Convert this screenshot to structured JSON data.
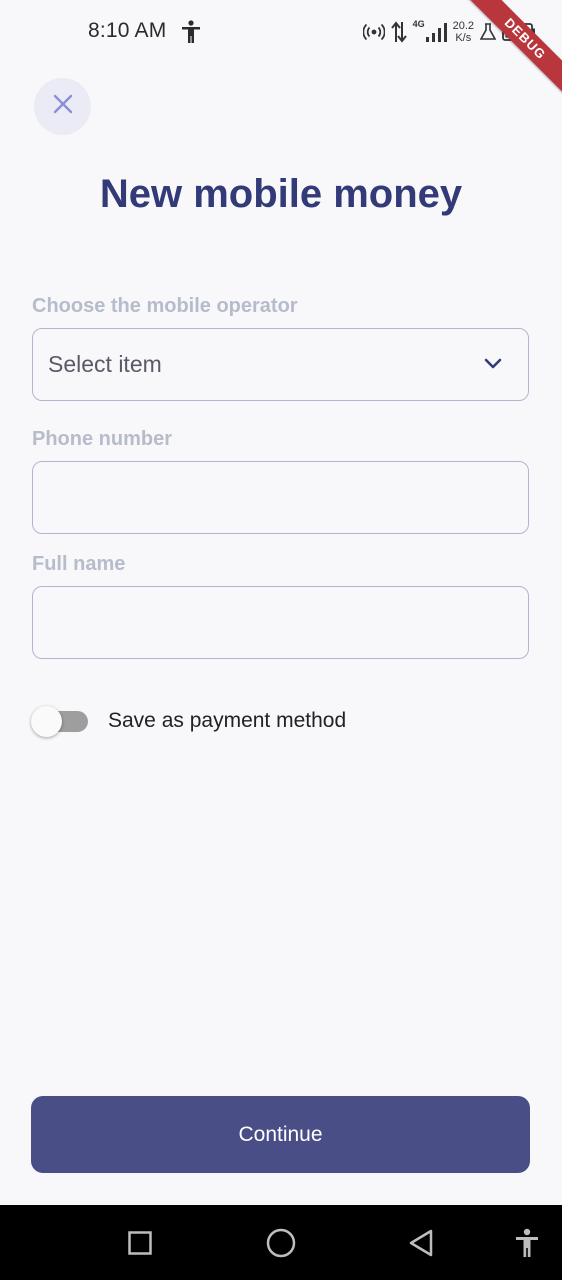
{
  "status_bar": {
    "time": "8:10 AM",
    "network_type": "4G",
    "net_speed_value": "20.2",
    "net_speed_unit": "K/s",
    "icons": [
      "accessibility-icon",
      "hotspot-icon",
      "data-arrows-icon",
      "signal-icon",
      "lab-icon",
      "battery-icon"
    ]
  },
  "debug_banner": "DEBUG",
  "close_icon": "close-icon",
  "page": {
    "title": "New mobile money"
  },
  "form": {
    "operator": {
      "label": "Choose the mobile operator",
      "value": "Select item"
    },
    "phone": {
      "label": "Phone number",
      "value": ""
    },
    "full_name": {
      "label": "Full name",
      "value": ""
    },
    "save_toggle": {
      "label": "Save as payment method",
      "on": false
    }
  },
  "continue_label": "Continue",
  "nav_bar": {
    "icons": [
      "recents-icon",
      "home-icon",
      "back-icon",
      "accessibility-icon"
    ]
  },
  "colors": {
    "title": "#333a78",
    "button": "#494e86",
    "label": "#b7bccb",
    "border": "#b5b4cf",
    "debug": "#b9373c"
  }
}
